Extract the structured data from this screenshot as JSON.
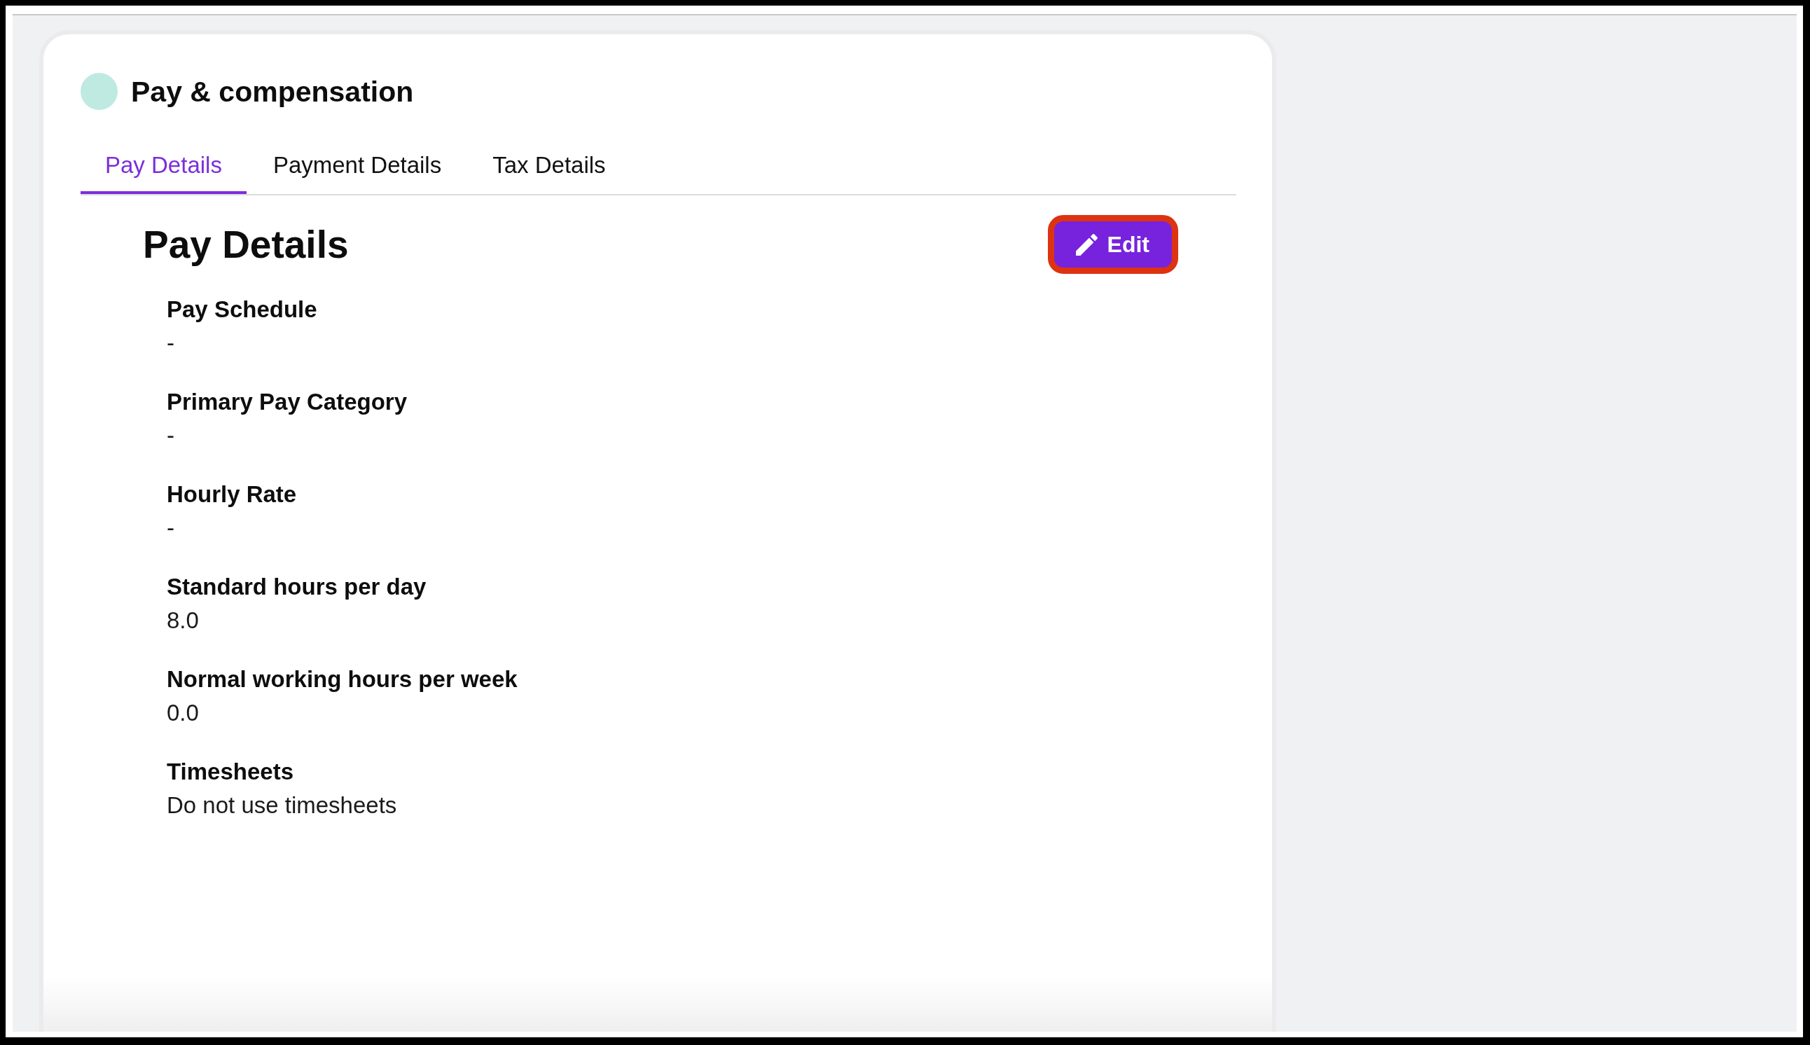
{
  "section": {
    "title": "Pay & compensation"
  },
  "tabs": [
    {
      "label": "Pay Details",
      "selected": true
    },
    {
      "label": "Payment Details",
      "selected": false
    },
    {
      "label": "Tax Details",
      "selected": false
    }
  ],
  "details": {
    "heading": "Pay Details",
    "edit_button": {
      "label": "Edit",
      "highlighted": true
    }
  },
  "fields": [
    {
      "label": "Pay Schedule",
      "value": "-"
    },
    {
      "label": "Primary Pay Category",
      "value": "-"
    },
    {
      "label": "Hourly Rate",
      "value": "-"
    },
    {
      "label": "Standard hours per day",
      "value": "8.0"
    },
    {
      "label": "Normal working hours per week",
      "value": "0.0"
    },
    {
      "label": "Timesheets",
      "value": "Do not use timesheets"
    }
  ]
}
